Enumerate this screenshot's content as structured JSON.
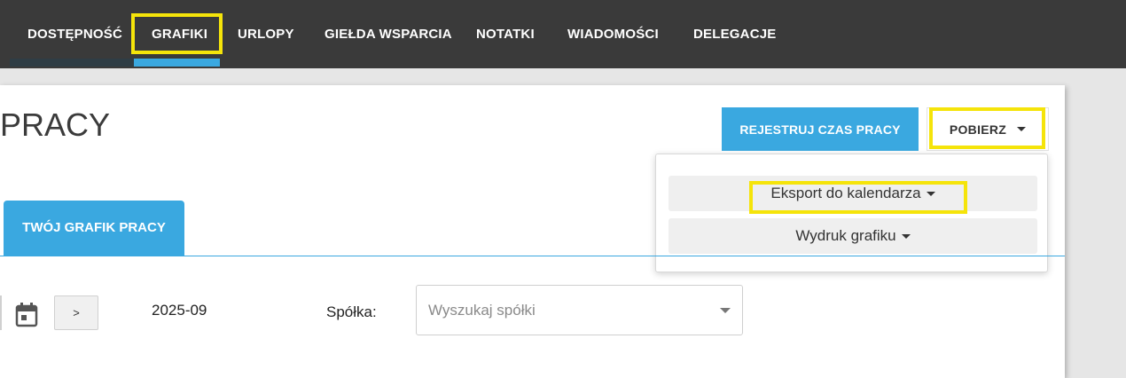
{
  "nav": {
    "items": [
      {
        "label": "DOSTĘPNOŚĆ"
      },
      {
        "label": "GRAFIKI"
      },
      {
        "label": "URLOPY"
      },
      {
        "label": "GIEŁDA WSPARCIA"
      },
      {
        "label": "NOTATKI"
      },
      {
        "label": "WIADOMOŚCI"
      },
      {
        "label": "DELEGACJE"
      }
    ],
    "active": "GRAFIKI"
  },
  "header": {
    "title": "PRACY",
    "register_button": "REJESTRUJ CZAS PRACY",
    "download_button": "POBIERZ"
  },
  "download_menu": {
    "items": [
      {
        "label": "Eksport do kalendarza"
      },
      {
        "label": "Wydruk grafiku"
      }
    ]
  },
  "tabs": [
    {
      "label": "TWÓJ GRAFIK PRACY"
    }
  ],
  "filters": {
    "next_label": ">",
    "period": "2025-09",
    "company_label": "Spółka:",
    "company_placeholder": "Wyszukaj spółki"
  },
  "colors": {
    "topbar": "#3a3a3a",
    "accent": "#3aa8e0",
    "highlight": "#f5e40a"
  },
  "icons": {
    "calendar": "calendar-icon",
    "caret": "caret-down-icon"
  }
}
